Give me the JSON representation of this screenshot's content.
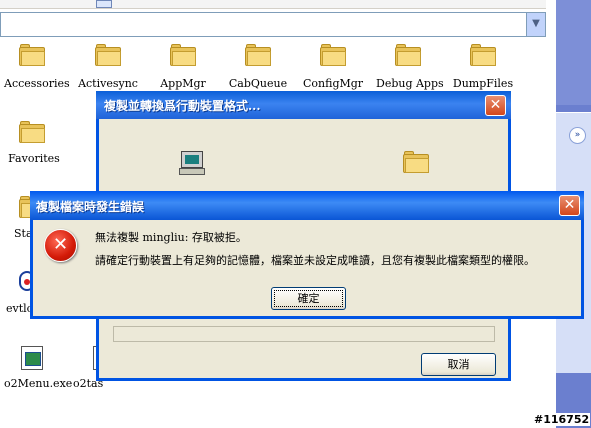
{
  "explorer": {
    "folders": [
      {
        "label": "Accessories"
      },
      {
        "label": "Activesync"
      },
      {
        "label": "AppMgr"
      },
      {
        "label": "CabQueue"
      },
      {
        "label": "ConfigMgr"
      },
      {
        "label": "Debug Apps"
      },
      {
        "label": "DumpFiles"
      },
      {
        "label": "Favorites"
      }
    ],
    "partial_items": [
      {
        "label": "Sta"
      },
      {
        "label": "evtlo"
      },
      {
        "label": "o2Menu.exe"
      },
      {
        "label": "o2tas"
      }
    ]
  },
  "copy_dialog": {
    "title": "複製並轉換爲行動裝置格式...",
    "cancel_label": "取消",
    "close_label": "✕"
  },
  "error_dialog": {
    "title": "複製檔案時發生錯誤",
    "message_line1": "無法複製 mingliu: 存取被拒。",
    "message_line2": "請確定行動裝置上有足夠的記憶體，檔案並未設定成唯讀，且您有複製此檔案類型的權限。",
    "ok_label": "確定",
    "close_label": "✕",
    "icon_glyph": "✕"
  },
  "task_pane": {
    "chevron_glyph": "»"
  },
  "address_bar": {
    "drop_glyph": "▼"
  },
  "watermark": "#116752",
  "colors": {
    "title_bar": "#0a5fd8",
    "dialog_face": "#ece9d8",
    "error_red": "#d31a08"
  }
}
